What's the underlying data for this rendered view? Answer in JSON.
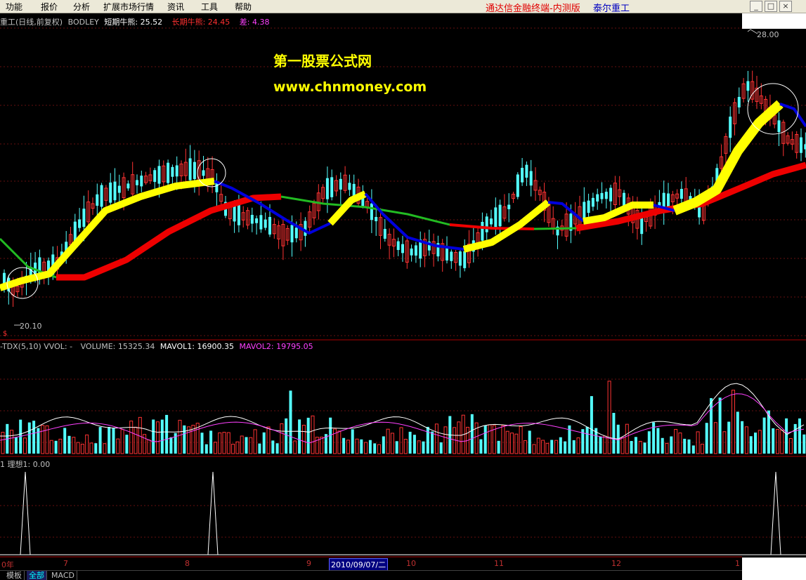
{
  "menu": [
    "功能",
    "报价",
    "分析",
    "扩展市场行情",
    "资讯",
    "工具",
    "帮助"
  ],
  "app_title": "通达信金融终端-内测版",
  "stock_name": "泰尔重工",
  "window_buttons": [
    "_",
    "□",
    "×"
  ],
  "main_panel": {
    "title": "重工(日线,前复权)",
    "indicator": "BODLEY",
    "short_label": "短期牛熊: 25.52",
    "long_label": "长期牛熊: 24.45",
    "diff_label": "差: 4.38",
    "high_label": "28.00",
    "low_label": "20.10",
    "colors": {
      "short_line": "#ffff00",
      "short_down": "#0000dd",
      "long_line": "#ee0000",
      "long_down": "#22bb22",
      "up_candle": "#ff3333",
      "down_candle": "#54ffff"
    }
  },
  "watermark": {
    "line1": "第一股票公式网",
    "line2": "www.chnmoney.com"
  },
  "volume_panel": {
    "title": "-TDX(5,10) VVOL: -",
    "volume": "VOLUME: 15325.34",
    "mavol1": "MAVOL1: 16900.35",
    "mavol2": "MAVOL2: 19795.05"
  },
  "signal_panel": {
    "title": "1  理想1: 0.00"
  },
  "x_axis": {
    "labels": [
      "0年",
      "7",
      "8",
      "9",
      "10",
      "11",
      "12",
      "1"
    ],
    "cursor_date": "2010/09/07/二"
  },
  "tabs": [
    "模板",
    "全部",
    "MACD"
  ],
  "active_tab": "全部",
  "left_marker": "$"
}
